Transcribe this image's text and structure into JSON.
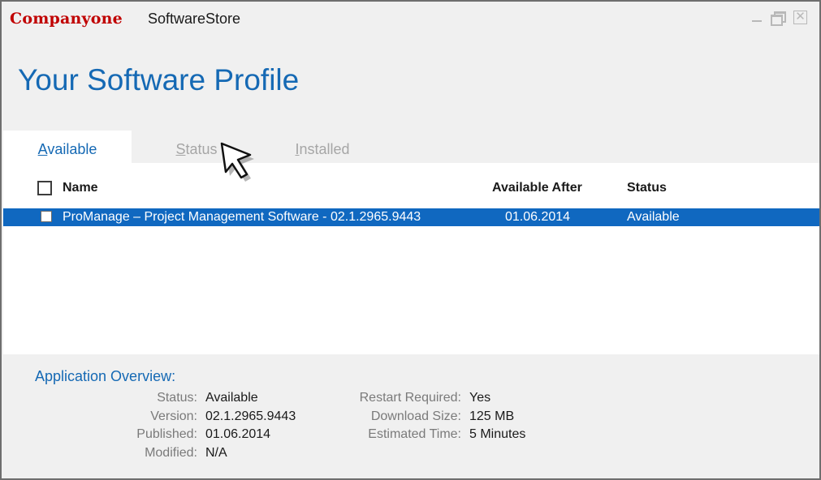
{
  "window": {
    "brand": "Companyone",
    "app_name": "SoftwareStore"
  },
  "page": {
    "title": "Your Software Profile"
  },
  "tabs": [
    {
      "label": "Available",
      "selected": true
    },
    {
      "label": "Status",
      "selected": false
    },
    {
      "label": "Installed",
      "selected": false
    }
  ],
  "table": {
    "columns": [
      "Name",
      "Available After",
      "Status"
    ],
    "rows": [
      {
        "name": "ProManage – Project Management Software - 02.1.2965.9443",
        "available_after": "01.06.2014",
        "status": "Available",
        "selected": true
      }
    ]
  },
  "overview": {
    "title": "Application Overview:",
    "left": [
      {
        "label": "Status:",
        "value": "Available"
      },
      {
        "label": "Version:",
        "value": "02.1.2965.9443"
      },
      {
        "label": "Published:",
        "value": "01.06.2014"
      },
      {
        "label": "Modified:",
        "value": "N/A"
      }
    ],
    "right": [
      {
        "label": "Restart Required:",
        "value": "Yes"
      },
      {
        "label": "Download Size:",
        "value": "125 MB"
      },
      {
        "label": "Estimated Time:",
        "value": "5 Minutes"
      }
    ]
  },
  "colors": {
    "brand": "#c00000",
    "accent": "#1569b4",
    "selection": "#1068c0"
  }
}
